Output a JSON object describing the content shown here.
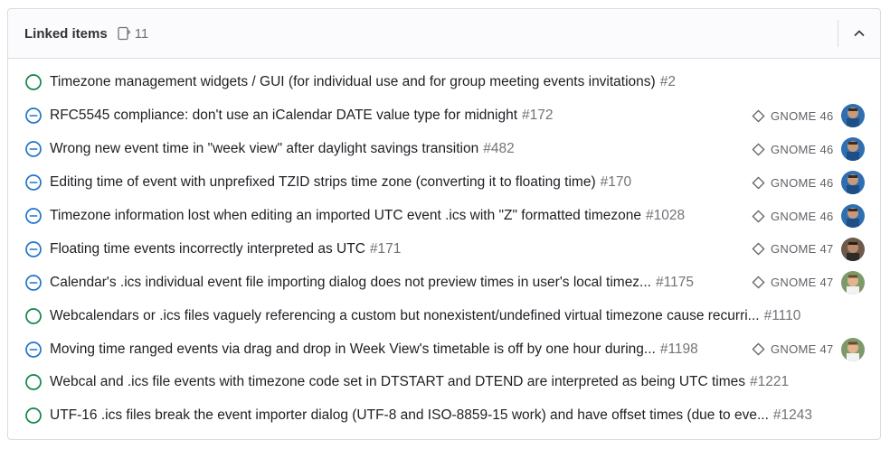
{
  "header": {
    "title": "Linked items",
    "count": "11"
  },
  "items": [
    {
      "status": "open",
      "title": "Timezone management widgets / GUI (for individual use and for group meeting events invitations)",
      "ref": "#2",
      "milestone": "",
      "avatar": ""
    },
    {
      "status": "blocked",
      "title": "RFC5545 compliance: don't use an iCalendar DATE value type for midnight",
      "ref": "#172",
      "milestone": "GNOME 46",
      "avatar": "user-a"
    },
    {
      "status": "blocked",
      "title": "Wrong new event time in \"week view\" after daylight savings transition",
      "ref": "#482",
      "milestone": "GNOME 46",
      "avatar": "user-a"
    },
    {
      "status": "blocked",
      "title": "Editing time of event with unprefixed TZID strips time zone (converting it to floating time)",
      "ref": "#170",
      "milestone": "GNOME 46",
      "avatar": "user-a"
    },
    {
      "status": "blocked",
      "title": "Timezone information lost when editing an imported UTC event .ics with \"Z\" formatted timezone",
      "ref": "#1028",
      "milestone": "GNOME 46",
      "avatar": "user-a"
    },
    {
      "status": "blocked",
      "title": "Floating time events incorrectly interpreted as UTC",
      "ref": "#171",
      "milestone": "GNOME 47",
      "avatar": "user-b"
    },
    {
      "status": "blocked",
      "title": "Calendar's .ics individual event file importing dialog does not preview times in user's local timez...",
      "ref": "#1175",
      "milestone": "GNOME 47",
      "avatar": "user-c"
    },
    {
      "status": "open",
      "title": "Webcalendars or .ics files vaguely referencing a custom but nonexistent/undefined virtual timezone cause recurri...",
      "ref": "#1110",
      "milestone": "",
      "avatar": ""
    },
    {
      "status": "blocked",
      "title": "Moving time ranged events via drag and drop in Week View's timetable is off by one hour during...",
      "ref": "#1198",
      "milestone": "GNOME 47",
      "avatar": "user-c"
    },
    {
      "status": "open",
      "title": "Webcal and .ics file events with timezone code set in DTSTART and DTEND are interpreted as being UTC times",
      "ref": "#1221",
      "milestone": "",
      "avatar": ""
    },
    {
      "status": "open",
      "title": "UTF-16 .ics files break the event importer dialog (UTF-8 and ISO-8859-15 work) and have offset times (due to eve...",
      "ref": "#1243",
      "milestone": "",
      "avatar": ""
    }
  ],
  "colors": {
    "open": "#108548",
    "blocked": "#1f75cb",
    "border": "#dcdcde"
  }
}
